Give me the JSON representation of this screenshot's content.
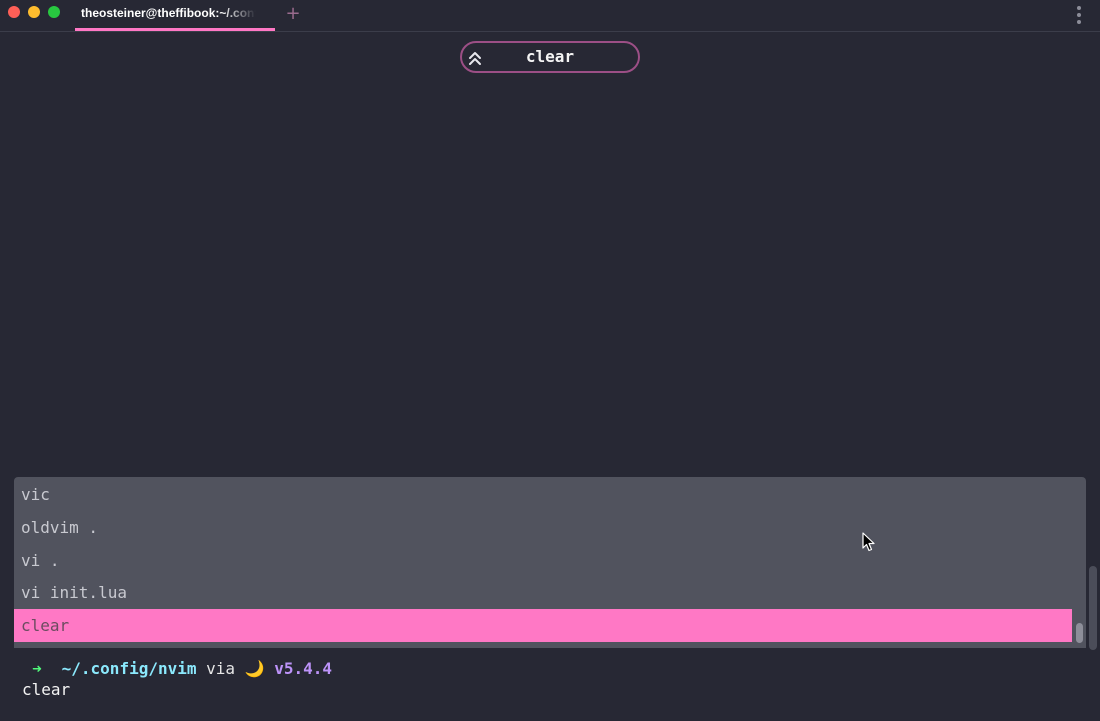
{
  "window": {
    "tab_title": "theosteiner@theffibook:~/.config/nvim",
    "new_tab_label": "+"
  },
  "search": {
    "query": "clear"
  },
  "history": {
    "items": [
      {
        "text": "vic",
        "selected": false
      },
      {
        "text": "oldvim .",
        "selected": false
      },
      {
        "text": "vi .",
        "selected": false
      },
      {
        "text": "vi init.lua",
        "selected": false
      },
      {
        "text": "clear",
        "selected": true
      }
    ]
  },
  "prompt": {
    "arrow": "➜",
    "path": "~/.config/nvim",
    "via": "via",
    "moon": "🌙",
    "version": "v5.4.4",
    "command": "clear"
  },
  "colors": {
    "background": "#272834",
    "accent_pink": "#ff78c5",
    "dropdown_bg": "#51535e",
    "prompt_arrow": "#50fa7b",
    "prompt_path": "#8be9fd",
    "prompt_version": "#bd93f9"
  },
  "icons": {
    "close": "close-icon",
    "minimize": "minimize-icon",
    "maximize": "maximize-icon",
    "search_mode": "chevrons-up-icon",
    "menu": "more-vertical-icon",
    "pointer": "mouse-pointer-icon"
  }
}
